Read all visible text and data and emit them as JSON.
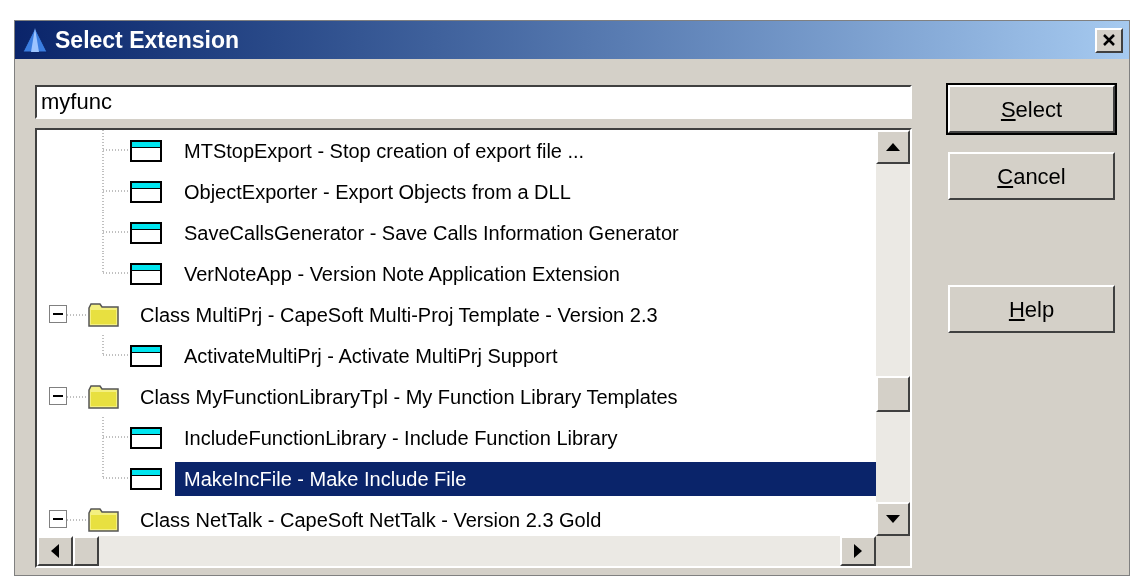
{
  "window": {
    "title": "Select Extension"
  },
  "search": {
    "value": "myfunc"
  },
  "tree": {
    "items": [
      {
        "kind": "group",
        "children": [
          {
            "kind": "extension",
            "label": "MTStopExport - Stop creation of export file ...",
            "selected": false
          },
          {
            "kind": "extension",
            "label": "ObjectExporter - Export Objects from a DLL",
            "selected": false
          },
          {
            "kind": "extension",
            "label": "SaveCallsGenerator - Save Calls Information Generator",
            "selected": false
          },
          {
            "kind": "extension",
            "label": "VerNoteApp - Version Note Application Extension",
            "selected": false
          }
        ]
      },
      {
        "kind": "class",
        "label": "Class MultiPrj - CapeSoft Multi-Proj Template - Version 2.3",
        "expanded": true,
        "children": [
          {
            "kind": "extension",
            "label": "ActivateMultiPrj - Activate MultiPrj Support",
            "selected": false
          }
        ]
      },
      {
        "kind": "class",
        "label": "Class MyFunctionLibraryTpl - My Function Library Templates",
        "expanded": true,
        "children": [
          {
            "kind": "extension",
            "label": "IncludeFunctionLibrary - Include Function Library",
            "selected": false
          },
          {
            "kind": "extension",
            "label": "MakeIncFile - Make Include File",
            "selected": true
          }
        ]
      },
      {
        "kind": "class",
        "label": "Class NetTalk - CapeSoft NetTalk - Version 2.3 Gold",
        "expanded": true
      }
    ]
  },
  "buttons": [
    {
      "label": "Select",
      "default": true,
      "underline_first": true
    },
    {
      "label": "Cancel",
      "default": false,
      "underline_first": true
    },
    {
      "label": "Help",
      "default": false,
      "underline_first": true
    }
  ]
}
